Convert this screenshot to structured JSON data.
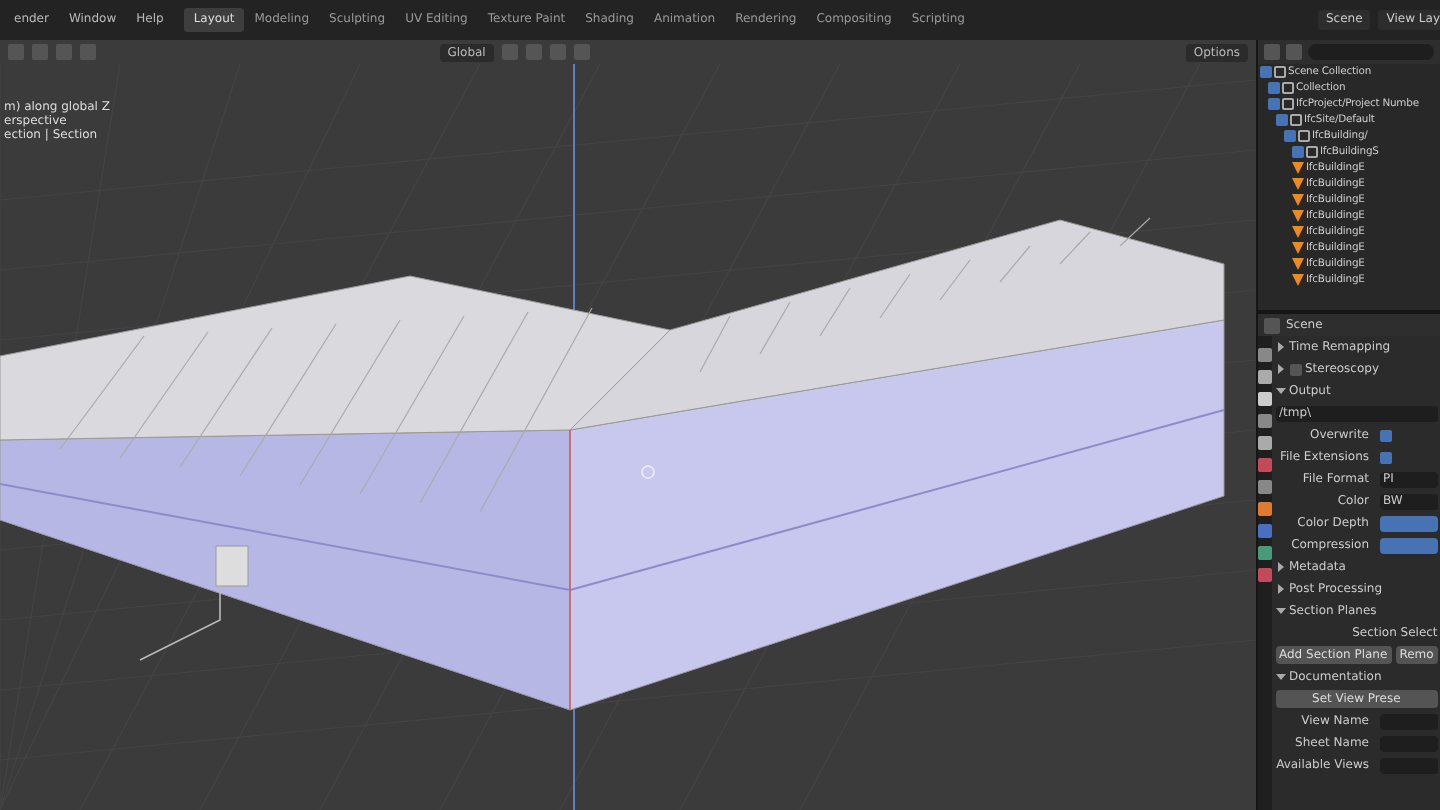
{
  "menu": [
    "ender",
    "Window",
    "Help"
  ],
  "workspace_tabs": [
    {
      "label": "Layout",
      "selected": true
    },
    {
      "label": "Modeling",
      "selected": false
    },
    {
      "label": "Sculpting",
      "selected": false
    },
    {
      "label": "UV Editing",
      "selected": false
    },
    {
      "label": "Texture Paint",
      "selected": false
    },
    {
      "label": "Shading",
      "selected": false
    },
    {
      "label": "Animation",
      "selected": false
    },
    {
      "label": "Rendering",
      "selected": false
    },
    {
      "label": "Compositing",
      "selected": false
    },
    {
      "label": "Scripting",
      "selected": false
    }
  ],
  "scene": "Scene",
  "view_layer": "View Lay",
  "viewport": {
    "orientation": "Global",
    "options": "Options",
    "overlay_text": [
      "m) along global Z",
      "erspective",
      "ection | Section"
    ]
  },
  "outliner": {
    "tree": [
      {
        "label": "Scene Collection",
        "kind": "collection",
        "checked": true,
        "children": [
          {
            "label": "Collection",
            "kind": "collection",
            "checked": true
          },
          {
            "label": "IfcProject/Project Numbe",
            "kind": "collection",
            "checked": true,
            "children": [
              {
                "label": "IfcSite/Default",
                "kind": "collection",
                "checked": true,
                "children": [
                  {
                    "label": "IfcBuilding/",
                    "kind": "collection",
                    "checked": true,
                    "children": [
                      {
                        "label": "IfcBuildingS",
                        "kind": "collection",
                        "checked": true
                      },
                      {
                        "label": "IfcBuildingE",
                        "kind": "object"
                      },
                      {
                        "label": "IfcBuildingE",
                        "kind": "object"
                      },
                      {
                        "label": "IfcBuildingE",
                        "kind": "object"
                      },
                      {
                        "label": "IfcBuildingE",
                        "kind": "object"
                      },
                      {
                        "label": "IfcBuildingE",
                        "kind": "object"
                      },
                      {
                        "label": "IfcBuildingE",
                        "kind": "object"
                      },
                      {
                        "label": "IfcBuildingE",
                        "kind": "object"
                      },
                      {
                        "label": "IfcBuildingE",
                        "kind": "object"
                      }
                    ]
                  }
                ]
              }
            ]
          }
        ]
      }
    ]
  },
  "properties": {
    "title": "Scene",
    "rows": [
      {
        "kind": "section",
        "label": "Time Remapping",
        "expanded": false
      },
      {
        "kind": "section",
        "label": "Stereoscopy",
        "expanded": false,
        "checked": false
      },
      {
        "kind": "section",
        "label": "Output",
        "expanded": true
      },
      {
        "kind": "path",
        "value": "/tmp\\"
      },
      {
        "kind": "checkbox",
        "label": "Overwrite",
        "checked": true
      },
      {
        "kind": "checkbox",
        "label": "File Extensions",
        "checked": true
      },
      {
        "kind": "field",
        "label": "File Format",
        "value": "PI"
      },
      {
        "kind": "field",
        "label": "Color",
        "value": "BW"
      },
      {
        "kind": "enum",
        "label": "Color Depth"
      },
      {
        "kind": "enum",
        "label": "Compression"
      },
      {
        "kind": "section",
        "label": "Metadata",
        "expanded": false
      },
      {
        "kind": "section",
        "label": "Post Processing",
        "expanded": false
      },
      {
        "kind": "section",
        "label": "Section Planes",
        "expanded": true
      },
      {
        "kind": "label",
        "label": "Section Select"
      },
      {
        "kind": "buttons",
        "labels": [
          "Add Section Plane",
          "Remo"
        ]
      },
      {
        "kind": "section",
        "label": "Documentation",
        "expanded": true
      },
      {
        "kind": "button",
        "label": "Set View Prese"
      },
      {
        "kind": "field",
        "label": "View Name"
      },
      {
        "kind": "field",
        "label": "Sheet Name"
      },
      {
        "kind": "field",
        "label": "Available Views"
      }
    ]
  }
}
